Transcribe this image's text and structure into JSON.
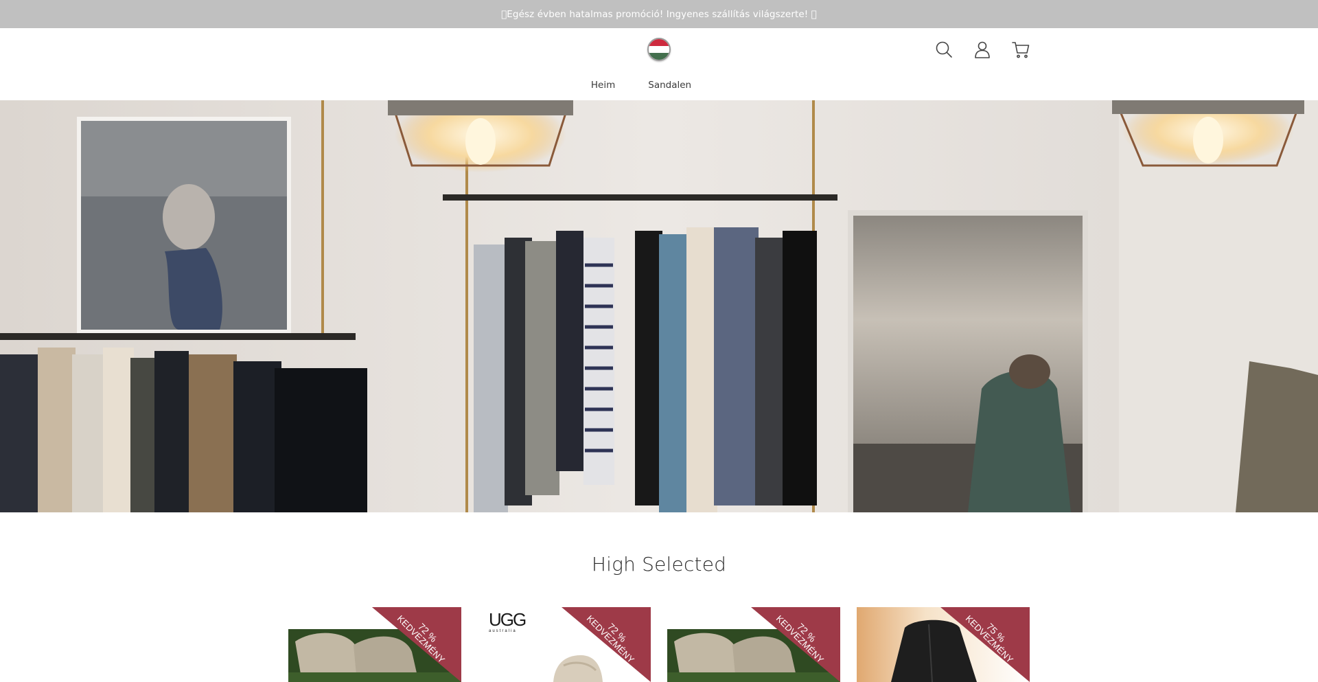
{
  "announcement": {
    "text": "\u0000Egész évben hatalmas promóció! Ingyenes szállítás világszerte! \u0000"
  },
  "header": {
    "logo_icon": "hungary-flag-icon",
    "icons": [
      "search-icon",
      "account-icon",
      "cart-icon"
    ]
  },
  "nav": {
    "items": [
      "Heim",
      "Sandalen"
    ]
  },
  "hero": {
    "image": "clothing-store-interior"
  },
  "section": {
    "title": "High Selected"
  },
  "products": [
    {
      "discount_pct": "72 %",
      "discount_label": "KEDVEZMÉNY",
      "image": "boots-on-moss"
    },
    {
      "discount_pct": "72 %",
      "discount_label": "KEDVEZMÉNY",
      "image": "ugg-shoe",
      "brand": "UGG",
      "brand_sub": "australia"
    },
    {
      "discount_pct": "72 %",
      "discount_label": "KEDVEZMÉNY",
      "image": "boots-on-moss"
    },
    {
      "discount_pct": "75 %",
      "discount_label": "KEDVEZMÉNY",
      "image": "black-jacket"
    }
  ],
  "colors": {
    "announcement_bg": "#c0c0c0",
    "ribbon": "#9e3a48",
    "text": "#2f2f2f"
  }
}
